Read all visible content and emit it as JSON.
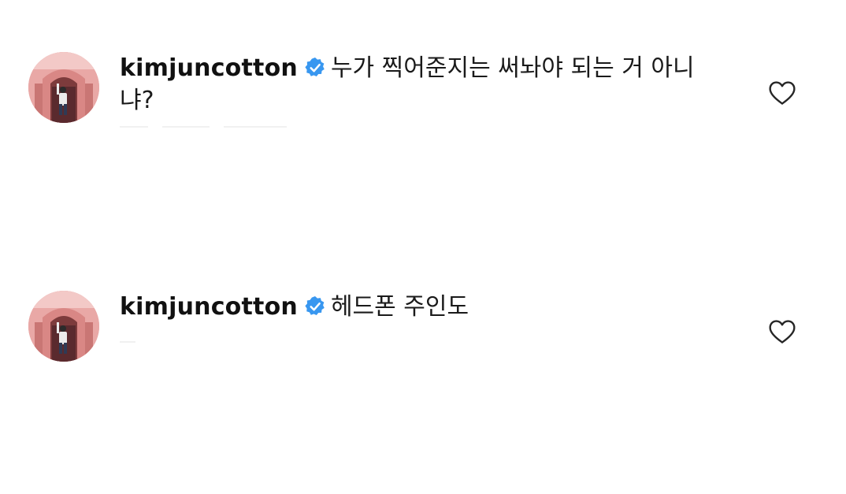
{
  "comments": [
    {
      "username": "kimjuncotton",
      "verified": true,
      "text": "누가 찍어준지는 써놔야 되는 거 아니냐?",
      "avatar_icon": "profile-photo-person-in-pink-arch",
      "like_icon": "heart-outline-icon"
    },
    {
      "username": "kimjuncotton",
      "verified": true,
      "text": "헤드폰 주인도",
      "avatar_icon": "profile-photo-person-in-pink-arch",
      "like_icon": "heart-outline-icon"
    }
  ],
  "colors": {
    "verified_badge": "#3897f0",
    "username": "#111111",
    "heart_stroke": "#262626",
    "avatar_bg": "#e7a3a2"
  }
}
